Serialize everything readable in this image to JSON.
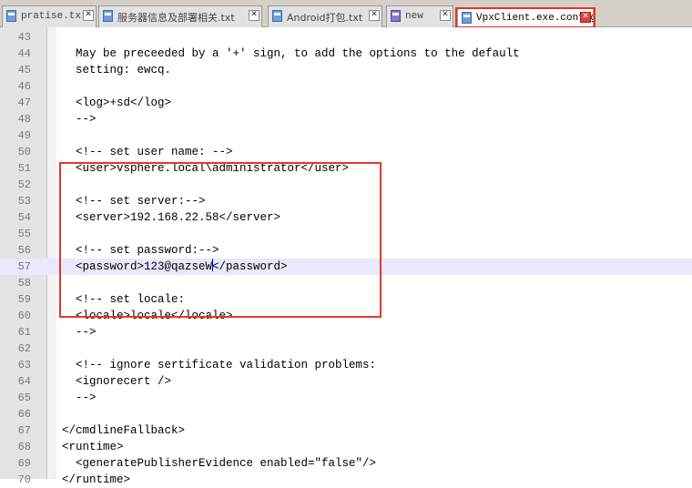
{
  "tabs": [
    {
      "label": "pratise.txt",
      "icon": "file-icon",
      "active": false
    },
    {
      "label": "服务器信息及部署相关.txt",
      "icon": "file-icon",
      "active": false
    },
    {
      "label": "Android打包.txt",
      "icon": "file-icon",
      "active": false
    },
    {
      "label": "new",
      "icon": "file-icon-purple",
      "active": false
    },
    {
      "label": "VpxClient.exe.config",
      "icon": "file-icon",
      "active": true
    }
  ],
  "close_glyph": "✕",
  "editor": {
    "lines": [
      {
        "num": "43",
        "text": ""
      },
      {
        "num": "44",
        "text": "  May be preceeded by a '+' sign, to add the options to the default"
      },
      {
        "num": "45",
        "text": "  setting: ewcq."
      },
      {
        "num": "46",
        "text": ""
      },
      {
        "num": "47",
        "text": "  <log>+sd</log>"
      },
      {
        "num": "48",
        "text": "  -->"
      },
      {
        "num": "49",
        "text": ""
      },
      {
        "num": "50",
        "text": "  <!-- set user name: -->"
      },
      {
        "num": "51",
        "text": "  <user>vsphere.local\\administrator</user>"
      },
      {
        "num": "52",
        "text": ""
      },
      {
        "num": "53",
        "text": "  <!-- set server:-->"
      },
      {
        "num": "54",
        "text": "  <server>192.168.22.58</server>"
      },
      {
        "num": "55",
        "text": ""
      },
      {
        "num": "56",
        "text": "  <!-- set password:-->"
      },
      {
        "num": "57",
        "text_before": "  <password>123@qazseW",
        "text_after": "</password>",
        "current": true
      },
      {
        "num": "58",
        "text": ""
      },
      {
        "num": "59",
        "text": "  <!-- set locale:"
      },
      {
        "num": "60",
        "text": "  <locale>locale</locale>"
      },
      {
        "num": "61",
        "text": "  -->"
      },
      {
        "num": "62",
        "text": ""
      },
      {
        "num": "63",
        "text": "  <!-- ignore sertificate validation problems:"
      },
      {
        "num": "64",
        "text": "  <ignorecert />"
      },
      {
        "num": "65",
        "text": "  -->"
      },
      {
        "num": "66",
        "text": ""
      },
      {
        "num": "67",
        "text": "</cmdlineFallback>"
      },
      {
        "num": "68",
        "text": "<runtime>"
      },
      {
        "num": "69",
        "text": "  <generatePublisherEvidence enabled=\"false\"/>"
      },
      {
        "num": "70",
        "text": "</runtime>"
      }
    ]
  },
  "colors": {
    "highlight_border": "#e8352a",
    "current_line": "#e8e8ff",
    "caret": "#0000ff"
  }
}
